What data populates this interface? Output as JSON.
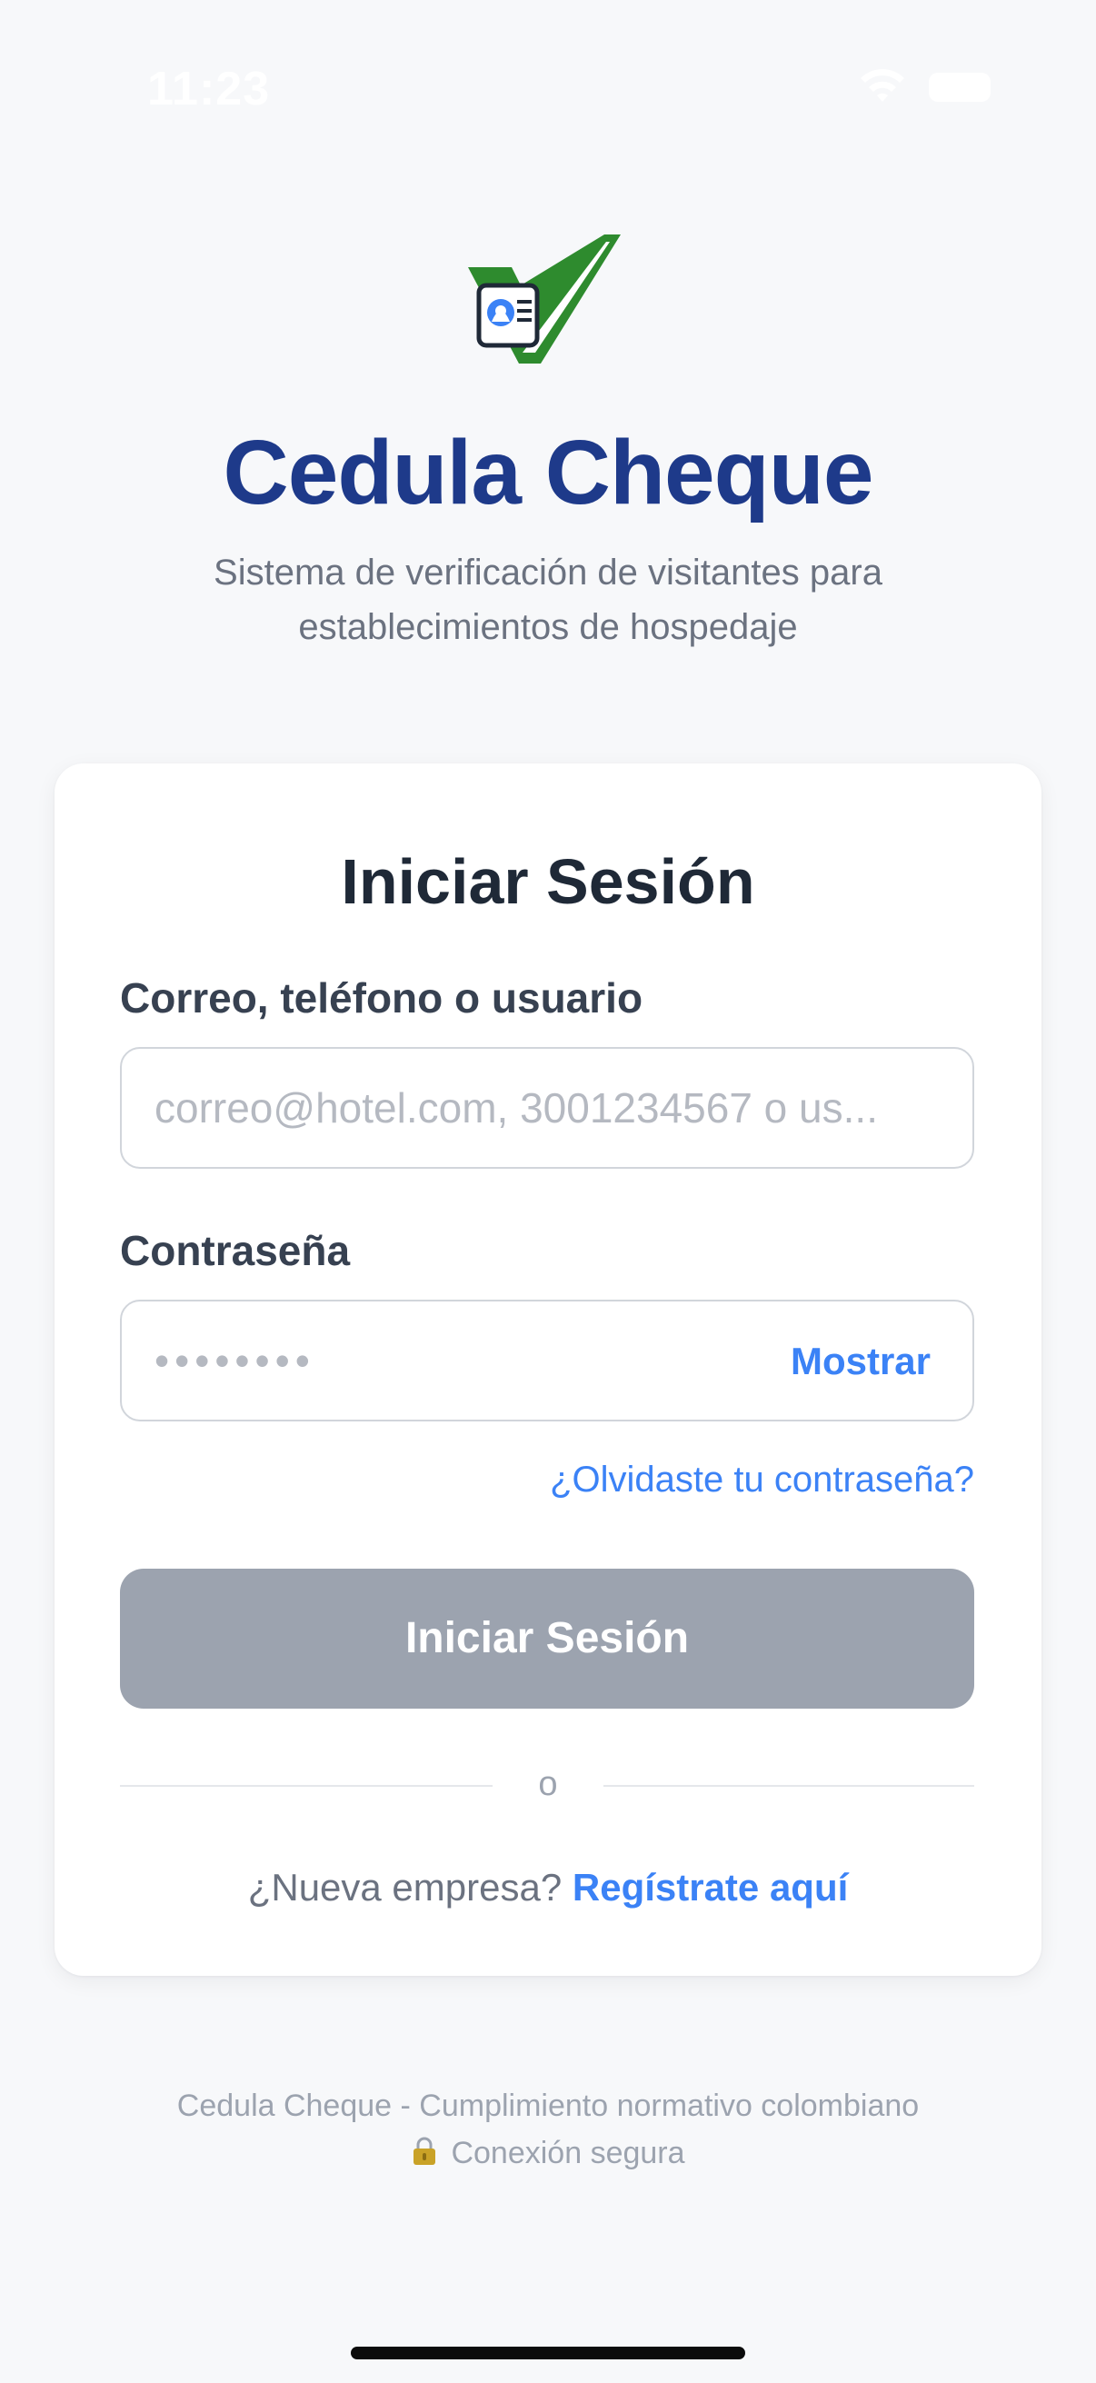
{
  "status_bar": {
    "time": "11:23"
  },
  "brand": {
    "logo_icon": "id-card-check-icon",
    "title": "Cedula Cheque",
    "subtitle": "Sistema de verificación de visitantes para establecimientos de hospedaje",
    "colors": {
      "title": "#1e3a8a",
      "check_green": "#2e8b2e",
      "card_blue": "#3b82f6"
    }
  },
  "login_card": {
    "title": "Iniciar Sesión",
    "user_field": {
      "label": "Correo, teléfono o usuario",
      "value": "",
      "placeholder": "correo@hotel.com, 3001234567 o us..."
    },
    "password_field": {
      "label": "Contraseña",
      "value": "",
      "placeholder": "••••••••",
      "show_label": "Mostrar"
    },
    "forgot_password": "¿Olvidaste tu contraseña?",
    "submit_label": "Iniciar Sesión",
    "divider_text": "o",
    "register_prompt": "¿Nueva empresa?",
    "register_link": "Regístrate aquí",
    "colors": {
      "accent": "#3b82f6",
      "button_disabled": "#9ca3af"
    }
  },
  "footer": {
    "line1": "Cedula Cheque - Cumplimiento normativo colombiano",
    "secure_icon": "lock-icon",
    "line2": "Conexión segura"
  }
}
